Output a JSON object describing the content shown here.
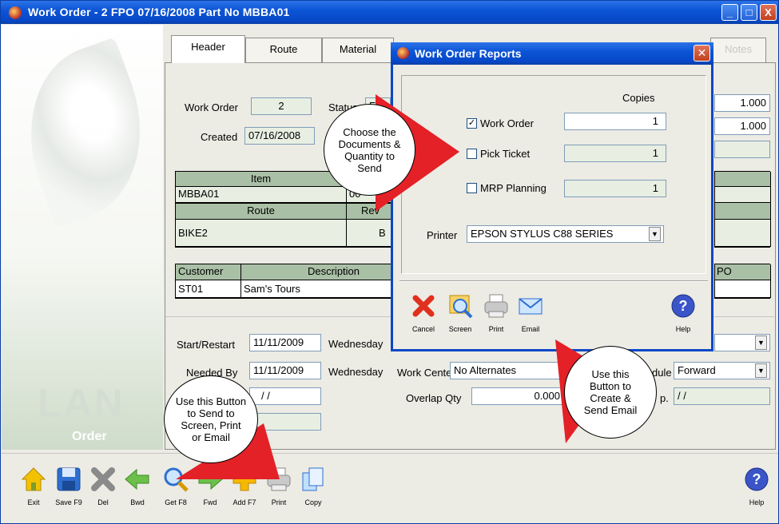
{
  "window": {
    "title": "Work Order - 2  FPO 07/16/2008  Part No MBBA01",
    "min": "_",
    "max": "□",
    "close": "X"
  },
  "branding": {
    "lan": "LAN",
    "order": "Order"
  },
  "tabs": [
    {
      "label": "Header"
    },
    {
      "label": "Route"
    },
    {
      "label": "Material"
    },
    {
      "label": "Notes"
    }
  ],
  "header": {
    "work_order_label": "Work Order",
    "work_order": "2",
    "status_label": "Status",
    "status": "F",
    "created_label": "Created",
    "created": "07/16/2008",
    "qty1": "1.000",
    "qty2": "1.000"
  },
  "item_grid": {
    "item_header": "Item",
    "item": "MBBA01",
    "col2_partial": "00",
    "route_header": "Route",
    "rev_header": "Rev",
    "route": "BIKE2",
    "rev_partial": "B"
  },
  "customer_grid": {
    "customer_header": "Customer",
    "description_header": "Description",
    "po_header": "PO",
    "customer": "ST01",
    "description": "Sam's Tours"
  },
  "schedule": {
    "start_label": "Start/Restart",
    "start": "11/11/2009",
    "start_day": "Wednesday",
    "needed_label": "Needed By",
    "needed": "11/11/2009",
    "needed_day": "Wednesday",
    "field3": "/ /",
    "work_center_label": "Work Center",
    "work_center": "No Alternates",
    "schedule_label": "dule",
    "schedule": "Forward",
    "overlap_label": "Overlap Qty",
    "overlap": "0.000",
    "p_label": "p.",
    "p_value": "/ /"
  },
  "toolbar": [
    {
      "label": "Exit",
      "icon": "home-icon"
    },
    {
      "label": "Save F9",
      "icon": "save-icon"
    },
    {
      "label": "Del",
      "icon": "delete-icon"
    },
    {
      "label": "Bwd",
      "icon": "back-arrow-icon"
    },
    {
      "label": "Get F8",
      "icon": "search-icon"
    },
    {
      "label": "Fwd",
      "icon": "forward-arrow-icon"
    },
    {
      "label": "Add F7",
      "icon": "add-icon"
    },
    {
      "label": "Print",
      "icon": "printer-icon"
    },
    {
      "label": "Copy",
      "icon": "copy-icon"
    },
    {
      "label": "Help",
      "icon": "help-icon"
    }
  ],
  "dialog": {
    "title": "Work Order Reports",
    "copies_label": "Copies",
    "reports": [
      {
        "label": "Work Order",
        "checked": true,
        "copies": "1"
      },
      {
        "label": "Pick Ticket",
        "checked": false,
        "copies": "1"
      },
      {
        "label": "MRP Planning",
        "checked": false,
        "copies": "1"
      }
    ],
    "printer_label": "Printer",
    "printer": "EPSON STYLUS C88 SERIES",
    "buttons": [
      {
        "label": "Cancel",
        "icon": "cancel-icon"
      },
      {
        "label": "Screen",
        "icon": "screen-icon"
      },
      {
        "label": "Print",
        "icon": "printer-icon"
      },
      {
        "label": "Email",
        "icon": "email-icon"
      },
      {
        "label": "Help",
        "icon": "help-icon"
      }
    ]
  },
  "callouts": {
    "documents": "Choose the Documents & Quantity to Send",
    "email": "Use this Button to Create & Send Email",
    "print": "Use this Button to Send to Screen, Print or Email"
  },
  "colors": {
    "titlebar": "#0c55d6",
    "grid_header": "#aac0a6",
    "readonly_field": "#e8efe2",
    "arrow": "#e32127"
  }
}
